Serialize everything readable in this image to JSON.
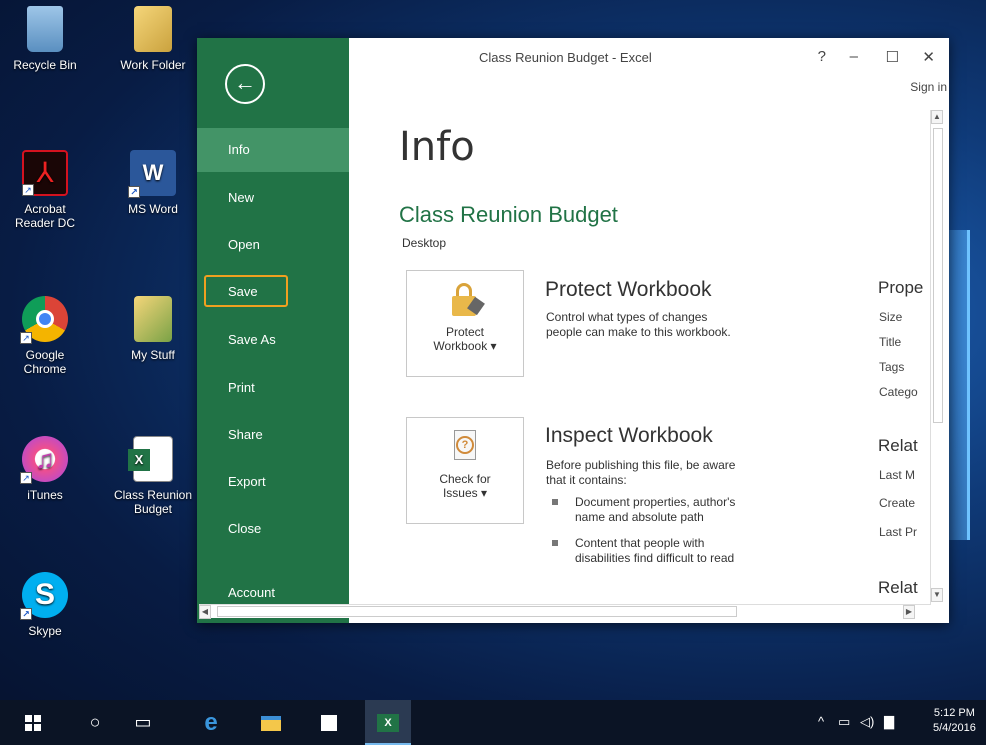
{
  "desktop": {
    "icons": [
      {
        "label": "Recycle Bin",
        "icon": "recycle-bin-icon"
      },
      {
        "label": "Work Folder",
        "icon": "folder-icon"
      },
      {
        "label": "Acrobat Reader DC",
        "line1": "Acrobat",
        "line2": "Reader DC",
        "icon": "acrobat-icon"
      },
      {
        "label": "MS Word",
        "icon": "word-icon"
      },
      {
        "label": "Google Chrome",
        "line1": "Google",
        "line2": "Chrome",
        "icon": "chrome-icon"
      },
      {
        "label": "My Stuff",
        "icon": "folder-icon"
      },
      {
        "label": "iTunes",
        "icon": "itunes-icon"
      },
      {
        "label": "Class Reunion Budget",
        "line1": "Class Reunion",
        "line2": "Budget",
        "icon": "excel-file-icon"
      },
      {
        "label": "Skype",
        "icon": "skype-icon"
      }
    ]
  },
  "window": {
    "title": "Class Reunion Budget - Excel",
    "help": "?",
    "minimize": "–",
    "maximize": "☐",
    "close": "✕",
    "signin": "Sign in"
  },
  "backstage": {
    "back_icon": "back-arrow-icon",
    "items": [
      "Info",
      "New",
      "Open",
      "Save",
      "Save As",
      "Print",
      "Share",
      "Export",
      "Close",
      "Account"
    ],
    "active": "Info",
    "highlighted": "Save",
    "accent_color": "#217346"
  },
  "info": {
    "heading": "Info",
    "workbook_name": "Class Reunion Budget",
    "location": "Desktop",
    "protect": {
      "button_line1": "Protect",
      "button_line2": "Workbook ▾",
      "title": "Protect Workbook",
      "desc_line1": "Control what types of changes",
      "desc_line2": "people can make to this workbook."
    },
    "inspect": {
      "button_line1": "Check for",
      "button_line2": "Issues ▾",
      "title": "Inspect Workbook",
      "desc_line1": "Before publishing this file, be aware",
      "desc_line2": "that it contains:",
      "bullet1_line1": "Document properties, author's",
      "bullet1_line2": "name and absolute path",
      "bullet2_line1": "Content that people with",
      "bullet2_line2": "disabilities find difficult to read"
    },
    "properties": {
      "heading": "Prope",
      "items": [
        "Size",
        "Title",
        "Tags",
        "Catego"
      ]
    },
    "related_dates": {
      "heading": "Relat",
      "items": [
        "Last M",
        "Create",
        "Last Pr"
      ]
    },
    "related_people": {
      "heading": "Relat"
    }
  },
  "taskbar": {
    "items": [
      "start-icon",
      "search-icon",
      "task-view-icon",
      "edge-icon",
      "file-explorer-icon",
      "store-icon",
      "excel-icon"
    ],
    "tray_icons": [
      "chevron-up-icon",
      "network-icon",
      "volume-icon",
      "notification-icon"
    ],
    "time": "5:12 PM",
    "date": "5/4/2016"
  }
}
